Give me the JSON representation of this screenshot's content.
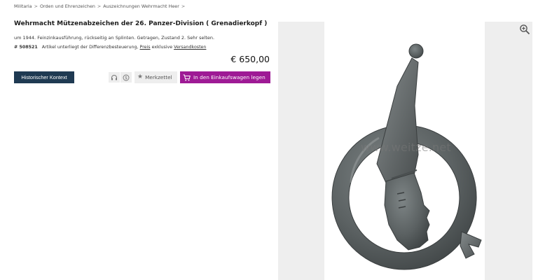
{
  "breadcrumb": [
    "Militaria",
    "Orden und Ehrenzeichen",
    "Auszeichnungen Wehrmacht Heer",
    ""
  ],
  "breadcrumb_sep": ">",
  "product": {
    "title": "Wehrmacht Mützenabzeichen der 26. Panzer-Division ( Grenadierkopf )",
    "description": "um 1944. Feinzinkausführung, rückseitig an Splinten. Getragen, Zustand 2. Sehr selten.",
    "article_number": "# 508521",
    "tax_note": "Artikel unterliegt der Differenzbesteuerung,",
    "price_link": "Preis",
    "tax_note2": "exklusive",
    "shipping_link": "Versandkosten",
    "price": "€ 650,00"
  },
  "buttons": {
    "historical": "Historischer Kontext",
    "watchlist": "Merkzettel",
    "cart": "In den Einkaufswagen legen"
  },
  "image": {
    "watermark": "www.weitze.net"
  },
  "icons": [
    "headphones-icon",
    "dollar-icon",
    "star-icon",
    "cart-icon",
    "zoom-in-icon"
  ],
  "colors": {
    "historical_button": "#1f3a52",
    "cart_button": "#9e1a95",
    "panel_background": "#eeeeee"
  }
}
